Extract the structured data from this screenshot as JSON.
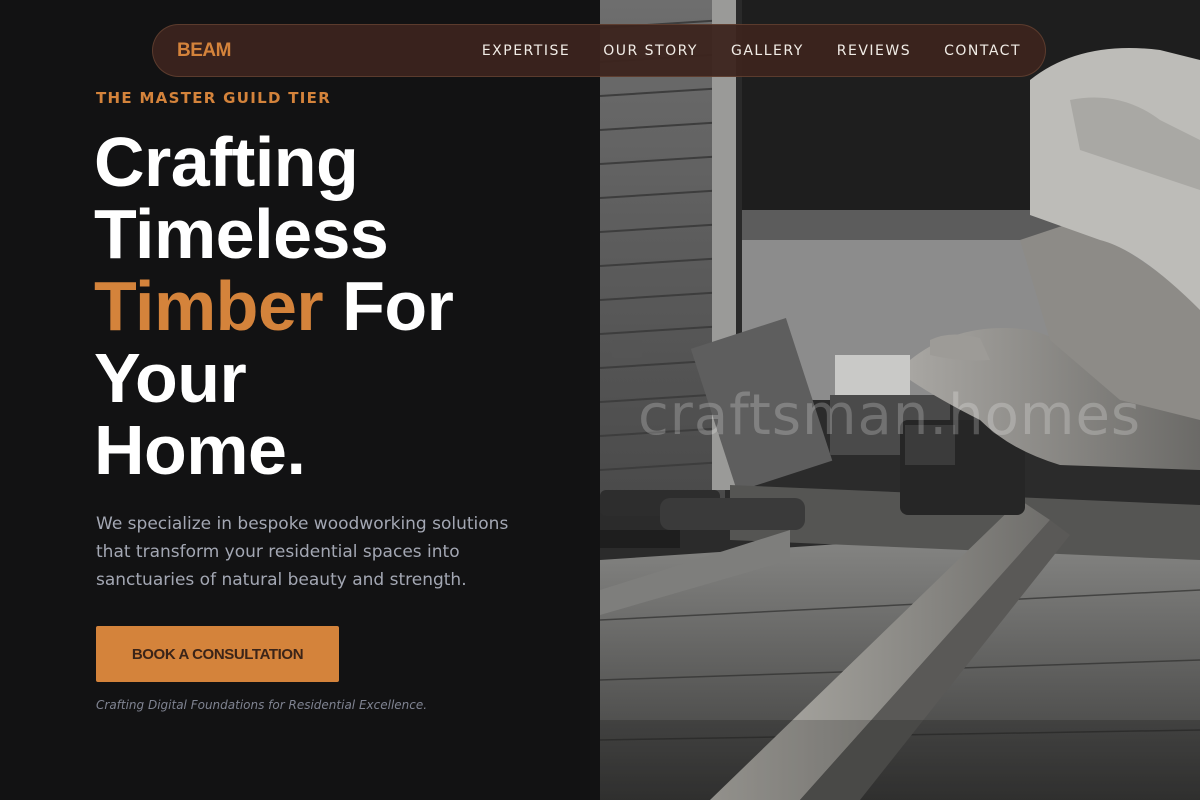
{
  "brand": {
    "logo": "BEAM",
    "accent_color": "#d4833b"
  },
  "nav": {
    "items": [
      {
        "label": "EXPERTISE"
      },
      {
        "label": "OUR STORY"
      },
      {
        "label": "GALLERY"
      },
      {
        "label": "REVIEWS"
      },
      {
        "label": "CONTACT"
      }
    ]
  },
  "hero": {
    "eyebrow": "THE MASTER GUILD TIER",
    "headline": {
      "line1": "Crafting",
      "line2": "Timeless",
      "accent": "Timber",
      "line3_rest": "For",
      "line4": "Your",
      "line5": "Home."
    },
    "description": "We specialize in bespoke woodworking solutions that transform your residential spaces into sanctuaries of natural beauty and strength.",
    "cta_label": "BOOK A CONSULTATION",
    "tagline": "Crafting Digital Foundations for Residential Excellence."
  },
  "photo": {
    "watermark": "craftsman.homes"
  }
}
